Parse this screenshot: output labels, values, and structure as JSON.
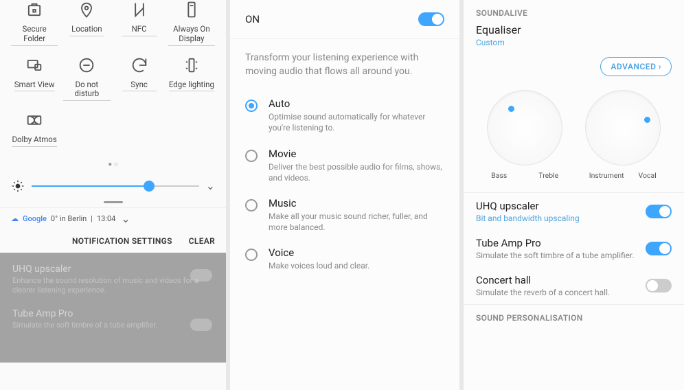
{
  "panel1": {
    "tiles": [
      {
        "label": "Secure Folder",
        "icon": "folder-lock"
      },
      {
        "label": "Location",
        "icon": "location-pin"
      },
      {
        "label": "NFC",
        "icon": "nfc"
      },
      {
        "label": "Always On Display",
        "icon": "aod"
      },
      {
        "label": "Smart View",
        "icon": "smart-view"
      },
      {
        "label": "Do not disturb",
        "icon": "dnd"
      },
      {
        "label": "Sync",
        "icon": "sync"
      },
      {
        "label": "Edge lighting",
        "icon": "edge-lighting"
      },
      {
        "label": "Dolby Atmos",
        "icon": "dolby"
      }
    ],
    "brightness_pct": 70,
    "status": {
      "provider": "Google",
      "weather": "0° in Berlin",
      "sep": "|",
      "time": "13:04"
    },
    "actions": {
      "settings": "NOTIFICATION SETTINGS",
      "clear": "CLEAR"
    },
    "dim_cards": [
      {
        "title": "UHQ upscaler",
        "sub": "Enhance the sound resolution of music and videos for a clearer listening experience."
      },
      {
        "title": "Tube Amp Pro",
        "sub": "Simulate the soft timbre of a tube amplifier."
      }
    ]
  },
  "panel2": {
    "on_label": "ON",
    "on_state": true,
    "description": "Transform your listening experience with moving audio that flows all around you.",
    "options": [
      {
        "title": "Auto",
        "sub": "Optimise sound automatically for whatever you're listening to.",
        "selected": true
      },
      {
        "title": "Movie",
        "sub": "Deliver the best possible audio for films, shows, and videos.",
        "selected": false
      },
      {
        "title": "Music",
        "sub": "Make all your music sound richer, fuller, and more balanced.",
        "selected": false
      },
      {
        "title": "Voice",
        "sub": "Make voices loud and clear.",
        "selected": false
      }
    ]
  },
  "panel3": {
    "section1": "SOUNDALIVE",
    "equaliser": {
      "title": "Equaliser",
      "sub": "Custom"
    },
    "advanced": "ADVANCED",
    "dial1": {
      "left": "Bass",
      "right": "Treble"
    },
    "dial2": {
      "left": "Instrument",
      "right": "Vocal"
    },
    "items": [
      {
        "title": "UHQ upscaler",
        "sub": "Bit and bandwidth upscaling",
        "sub_blue": true,
        "on": true
      },
      {
        "title": "Tube Amp Pro",
        "sub": "Simulate the soft timbre of a tube amplifier.",
        "sub_blue": false,
        "on": true
      },
      {
        "title": "Concert hall",
        "sub": "Simulate the reverb of a concert hall.",
        "sub_blue": false,
        "on": false
      }
    ],
    "section2": "SOUND PERSONALISATION"
  }
}
